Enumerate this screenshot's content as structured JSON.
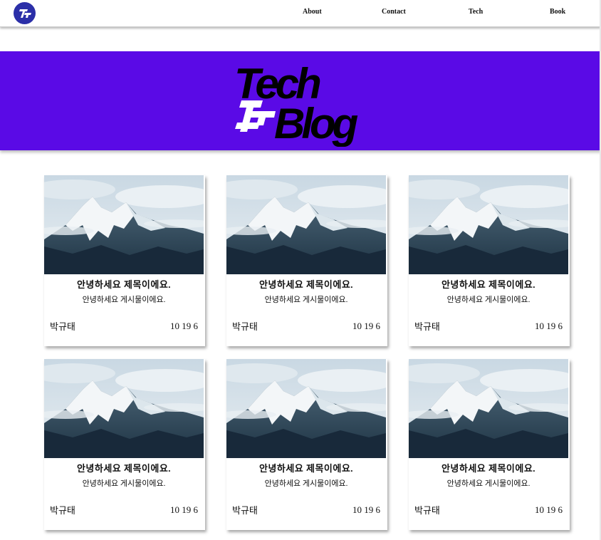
{
  "nav": {
    "logo_icon": "tf-logo-icon",
    "links": [
      "About",
      "Contact",
      "Tech",
      "Book"
    ]
  },
  "hero": {
    "logo_word1": "Tech",
    "logo_mark": "TF",
    "logo_word2": "Blog",
    "background": "#5a0ae6"
  },
  "posts": [
    {
      "title": "안녕하세요 제목이에요.",
      "body": "안녕하세요 게시물이에요.",
      "author": "박규태",
      "date": "10 19 6"
    },
    {
      "title": "안녕하세요 제목이에요.",
      "body": "안녕하세요 게시물이에요.",
      "author": "박규태",
      "date": "10 19 6"
    },
    {
      "title": "안녕하세요 제목이에요.",
      "body": "안녕하세요 게시물이에요.",
      "author": "박규태",
      "date": "10 19 6"
    },
    {
      "title": "안녕하세요 제목이에요.",
      "body": "안녕하세요 게시물이에요.",
      "author": "박규태",
      "date": "10 19 6"
    },
    {
      "title": "안녕하세요 제목이에요.",
      "body": "안녕하세요 게시물이에요.",
      "author": "박규태",
      "date": "10 19 6"
    },
    {
      "title": "안녕하세요 제목이에요.",
      "body": "안녕하세요 게시물이에요.",
      "author": "박규태",
      "date": "10 19 6"
    }
  ],
  "post_image_icon": "mountain-photo"
}
